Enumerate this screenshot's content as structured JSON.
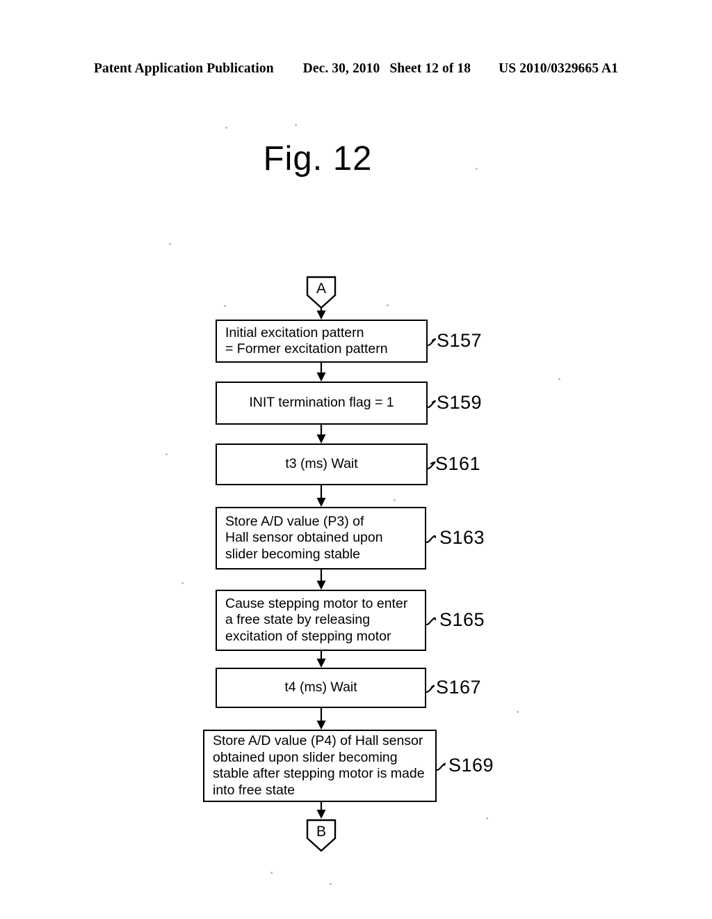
{
  "header": {
    "publication": "Patent Application Publication",
    "date": "Dec. 30, 2010",
    "sheet": "Sheet 12 of 18",
    "doc_number": "US 2010/0329665 A1"
  },
  "figure": {
    "title": "Fig. 12"
  },
  "flowchart": {
    "entry_connector": {
      "name": "connector-a",
      "label": "A"
    },
    "exit_connector": {
      "name": "connector-b",
      "label": "B"
    },
    "steps": [
      {
        "id": "S157",
        "text": "Initial excitation pattern\n= Former excitation pattern",
        "align": "left",
        "label": "S157"
      },
      {
        "id": "S159",
        "text": "INIT termination flag = 1",
        "align": "center",
        "label": "S159"
      },
      {
        "id": "S161",
        "text": "t3 (ms) Wait",
        "align": "center",
        "label": "S161"
      },
      {
        "id": "S163",
        "text": "Store A/D value (P3) of\nHall sensor obtained upon\nslider becoming stable",
        "align": "left",
        "label": "S163"
      },
      {
        "id": "S165",
        "text": "Cause stepping motor to enter\na free state by releasing\nexcitation of stepping motor",
        "align": "left",
        "label": "S165"
      },
      {
        "id": "S167",
        "text": "t4 (ms) Wait",
        "align": "center",
        "label": "S167"
      },
      {
        "id": "S169",
        "text": "Store A/D value (P4) of Hall sensor\nobtained upon slider becoming\nstable after stepping motor is made\ninto free state",
        "align": "left",
        "label": "S169"
      }
    ]
  },
  "colors": {
    "ink": "#000000",
    "paper": "#ffffff"
  }
}
